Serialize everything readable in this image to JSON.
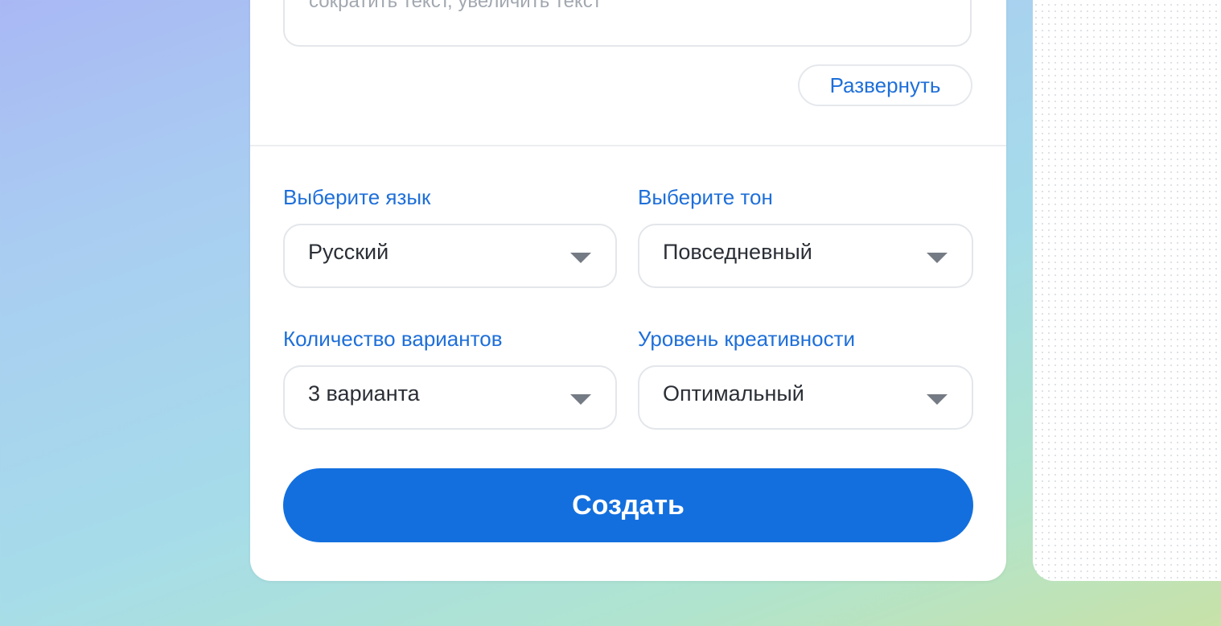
{
  "form": {
    "textarea_placeholder": "сократить текст, увеличить текст",
    "expand_label": "Развернуть",
    "language": {
      "label": "Выберите язык",
      "value": "Русский"
    },
    "tone": {
      "label": "Выберите тон",
      "value": "Повседневный"
    },
    "variants": {
      "label": "Количество вариантов",
      "value": "3 варианта"
    },
    "creativity": {
      "label": "Уровень креативности",
      "value": "Оптимальный"
    },
    "submit_label": "Создать"
  },
  "icons": {
    "dropdown": "chevron-down-icon"
  },
  "colors": {
    "accent": "#136fde",
    "label": "#1e6fd9",
    "text": "#2b2f36"
  }
}
